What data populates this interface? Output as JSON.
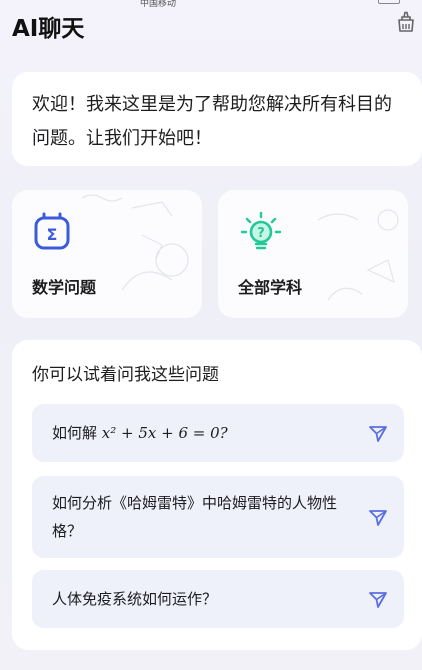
{
  "status_bar": {
    "carrier": "中国移动"
  },
  "header": {
    "title": "AI聊天"
  },
  "welcome": {
    "text": "欢迎！我来这里是为了帮助您解决所有科目的问题。让我们开始吧！"
  },
  "features": [
    {
      "label": "数学问题",
      "icon": "sigma-icon",
      "color": "#3b5bdb"
    },
    {
      "label": "全部学科",
      "icon": "lightbulb-icon",
      "color": "#20c997"
    }
  ],
  "suggestions": {
    "title": "你可以试着问我这些问题",
    "items": [
      {
        "prefix": "如何解",
        "math": "x² + 5x + 6 = 0?"
      },
      {
        "text": "如何分析《哈姆雷特》中哈姆雷特的人物性格？"
      },
      {
        "text": "人体免疫系统如何运作？"
      }
    ]
  },
  "colors": {
    "accent": "#5b6ee1",
    "card_bg": "#ffffff",
    "question_bg": "#eef0fa"
  }
}
